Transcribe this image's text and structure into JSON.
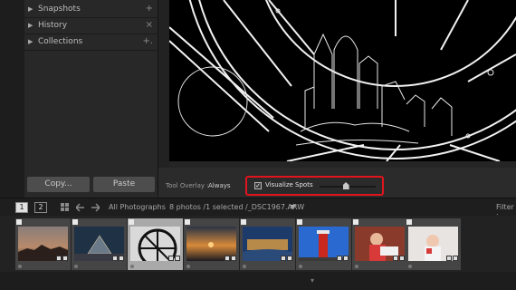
{
  "left_panel": {
    "sections": [
      {
        "label": "Snapshots",
        "action": "+"
      },
      {
        "label": "History",
        "action": "×"
      },
      {
        "label": "Collections",
        "action": "+."
      }
    ],
    "copy_label": "Copy...",
    "paste_label": "Paste"
  },
  "toolbar": {
    "tool_overlay_label": "Tool Overlay :",
    "tool_overlay_value": "Always",
    "visualize_label": "Visualize Spots",
    "visualize_checked": true,
    "check_glyph": "✓",
    "threshold_level": 0.47,
    "highlight_color": "#e0141c"
  },
  "filmstrip_bar": {
    "page1": "1",
    "page2": "2",
    "source": "All Photographs",
    "info": "8 photos /1 selected /_DSC1967.ARW",
    "filter_label": "Filter :"
  },
  "filmstrip": {
    "selected_index": 2,
    "thumbnails": [
      {
        "subject": "sunset-city"
      },
      {
        "subject": "louvre-dusk"
      },
      {
        "subject": "clock-window"
      },
      {
        "subject": "sunset-sea"
      },
      {
        "subject": "palace-bridge"
      },
      {
        "subject": "red-lighthouse"
      },
      {
        "subject": "child-reading"
      },
      {
        "subject": "snow-child"
      }
    ]
  },
  "icons": {
    "grid": "grid-view-icon",
    "back": "back-arrow-icon",
    "forward": "forward-arrow-icon",
    "dropdown": "dropdown-arrow-icon"
  }
}
